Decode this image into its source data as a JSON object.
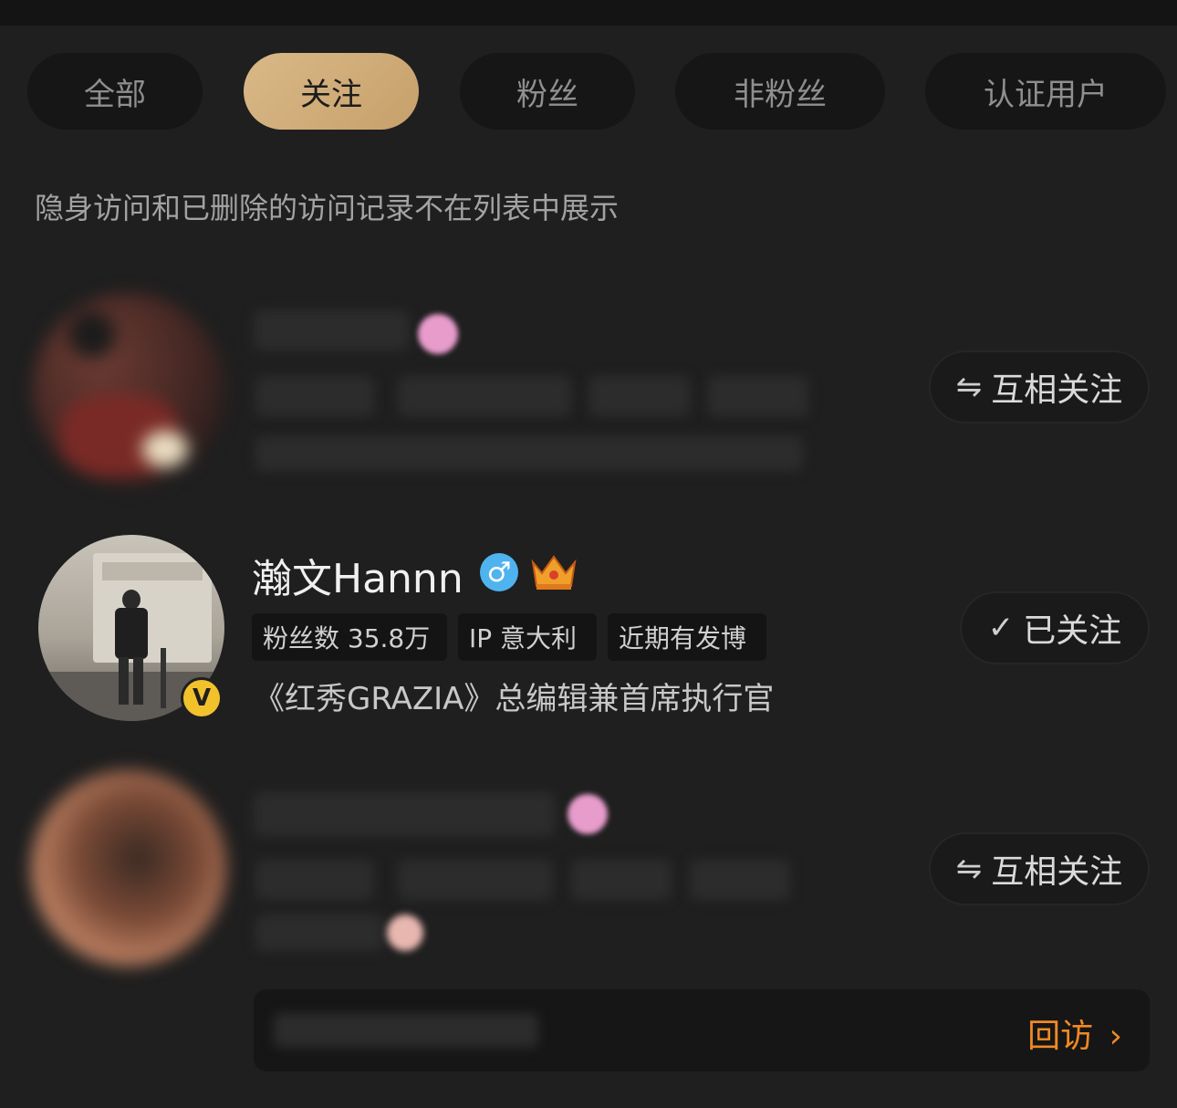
{
  "tabs": [
    {
      "label": "全部",
      "active": false
    },
    {
      "label": "关注",
      "active": true
    },
    {
      "label": "粉丝",
      "active": false
    },
    {
      "label": "非粉丝",
      "active": false
    },
    {
      "label": "认证用户",
      "active": false
    }
  ],
  "notice": "隐身访问和已删除的访问记录不在列表中展示",
  "visitors": [
    {
      "blurred": true,
      "action": {
        "icon": "mutual-follow-icon",
        "label": "互相关注"
      }
    },
    {
      "blurred": false,
      "name": "瀚文Hannn",
      "gender_icon": "male-icon",
      "badge_icon": "crown-icon",
      "verified_icon": "verified-v-icon",
      "verified_letter": "V",
      "stats": [
        "粉丝数 35.8万",
        "IP 意大利",
        "近期有发博"
      ],
      "bio": "《红秀GRAZIA》总编辑兼首席执行官",
      "action": {
        "icon": "check-icon",
        "label": "已关注"
      }
    },
    {
      "blurred": true,
      "action": {
        "icon": "mutual-follow-icon",
        "label": "互相关注"
      }
    }
  ],
  "visit_back": {
    "label": "回访",
    "chevron": "›"
  },
  "colors": {
    "accent_gold": "#d4b282",
    "link_orange": "#f08a24",
    "background": "#1f1f1f"
  }
}
